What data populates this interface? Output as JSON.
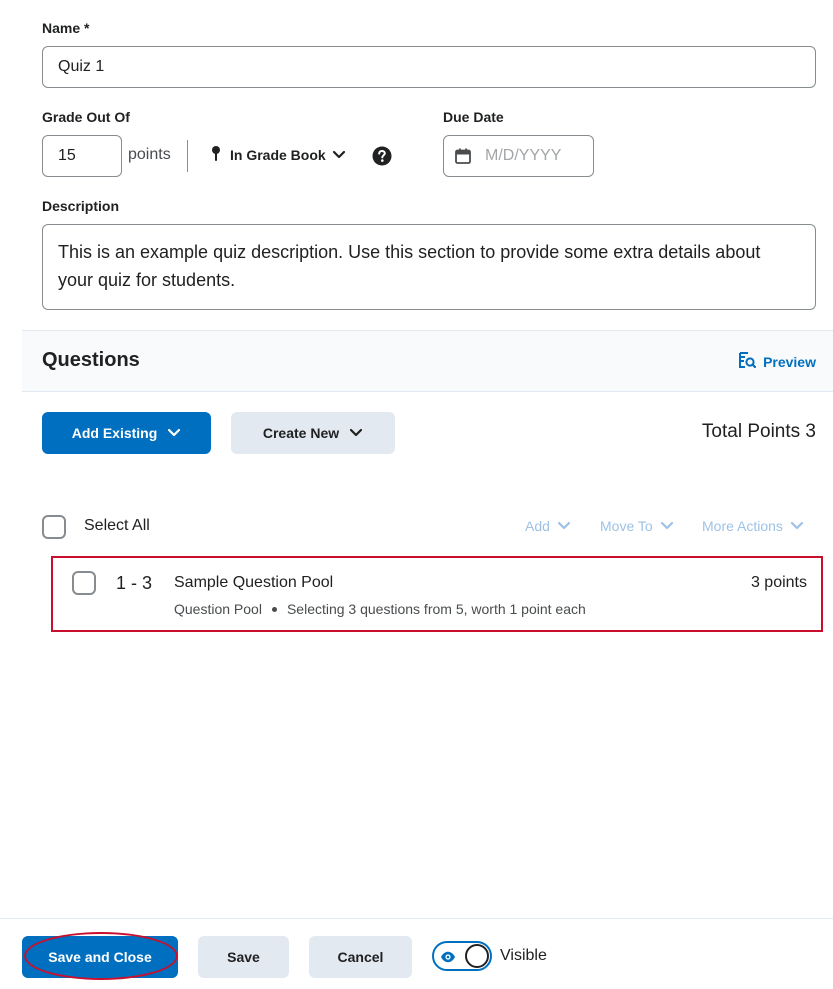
{
  "form": {
    "name_label": "Name *",
    "name_value": "Quiz 1",
    "grade_label": "Grade Out Of",
    "grade_value": "15",
    "points_label": "points",
    "gradebook_label": "In Grade Book",
    "due_label": "Due Date",
    "due_placeholder": "M/D/YYYY",
    "desc_label": "Description",
    "desc_value": "This is an example quiz description. Use this section to provide some extra details about your quiz for students."
  },
  "questions": {
    "title": "Questions",
    "preview_label": "Preview",
    "add_existing_label": "Add Existing",
    "create_new_label": "Create New",
    "total_points": "Total Points 3",
    "select_all_label": "Select All",
    "actions": {
      "add": "Add",
      "move_to": "Move To",
      "more_actions": "More Actions"
    },
    "items": [
      {
        "range": "1 - 3",
        "title": "Sample Question Pool",
        "points": "3 points",
        "type": "Question Pool",
        "detail": "Selecting 3 questions from 5, worth 1 point each"
      }
    ]
  },
  "footer": {
    "save_close_label": "Save and Close",
    "save_label": "Save",
    "cancel_label": "Cancel",
    "visible_label": "Visible"
  },
  "colors": {
    "accent": "#006fbf",
    "highlight": "#c8102e",
    "secondary_button": "#e3e9f1"
  },
  "icons": {
    "gradebook": "pin-icon",
    "help": "help-icon",
    "due": "calendar-icon",
    "preview": "preview-icon",
    "dropdown": "chevron-down-icon",
    "visibility": "eye-icon"
  }
}
